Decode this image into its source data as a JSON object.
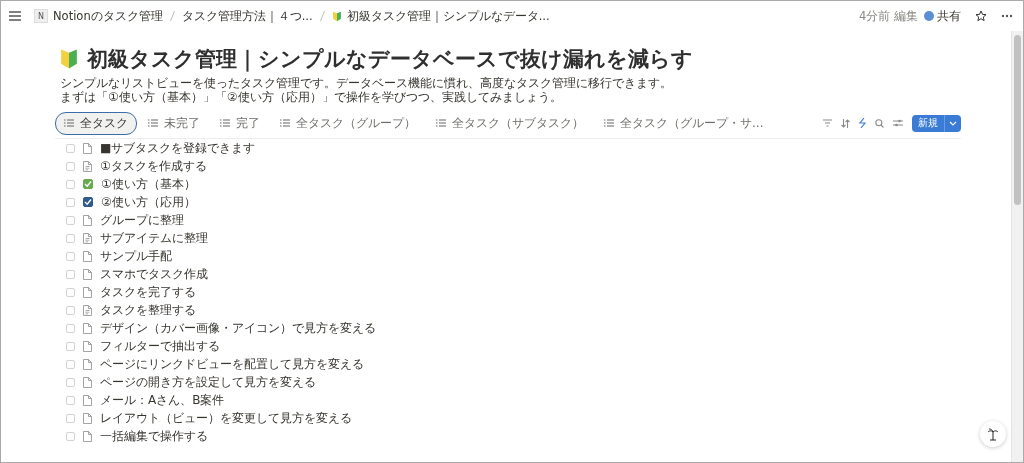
{
  "topbar": {
    "breadcrumbs": [
      {
        "text": "Notionのタスク管理",
        "icon": "N"
      },
      {
        "text": "タスク管理方法｜４つ..."
      },
      {
        "text": "初級タスク管理｜シンプルなデータ..."
      }
    ],
    "edited": "4分前 編集",
    "share": "共有"
  },
  "page": {
    "title": "初級タスク管理｜シンプルなデータベースで抜け漏れを減らす",
    "description": [
      "シンプルなリストビューを使ったタスク管理です。データベース機能に慣れ、高度なタスク管理に移行できます。",
      "まずは「①使い方（基本）」「②使い方（応用）」で操作を学びつつ、実践してみましょう。"
    ]
  },
  "views": [
    {
      "label": "全タスク",
      "selected": true
    },
    {
      "label": "未完了",
      "selected": false
    },
    {
      "label": "完了",
      "selected": false
    },
    {
      "label": "全タスク（グループ）",
      "selected": false
    },
    {
      "label": "全タスク（サブタスク）",
      "selected": false
    },
    {
      "label": "全タスク（グループ・サ...",
      "selected": false
    }
  ],
  "new_button": "新規",
  "items": [
    {
      "kind": "page",
      "title": "■サブタスクを登録できます",
      "selected": false
    },
    {
      "kind": "doc",
      "title": "①タスクを作成する",
      "selected": false
    },
    {
      "kind": "checkbox",
      "title": "①使い方（基本）",
      "checked": true,
      "color": "#6aa84f",
      "selected": false
    },
    {
      "kind": "checkbox",
      "title": "②使い方（応用）",
      "checked": true,
      "color": "#2f5a8a",
      "selected": false
    },
    {
      "kind": "page",
      "title": "グループに整理",
      "selected": false
    },
    {
      "kind": "doc",
      "title": "サブアイテムに整理",
      "selected": false
    },
    {
      "kind": "page",
      "title": "サンプル手配",
      "selected": false
    },
    {
      "kind": "page",
      "title": "スマホでタスク作成",
      "selected": false
    },
    {
      "kind": "page",
      "title": "タスクを完了する",
      "selected": false
    },
    {
      "kind": "doc",
      "title": "タスクを整理する",
      "selected": false
    },
    {
      "kind": "page",
      "title": "デザイン（カバー画像・アイコン）で見方を変える",
      "selected": false
    },
    {
      "kind": "page",
      "title": "フィルターで抽出する",
      "selected": false
    },
    {
      "kind": "page",
      "title": "ページにリンクドビューを配置して見方を変える",
      "selected": false
    },
    {
      "kind": "page",
      "title": "ページの開き方を設定して見方を変える",
      "selected": false
    },
    {
      "kind": "page",
      "title": "メール：Aさん、B案件",
      "selected": false
    },
    {
      "kind": "page",
      "title": "レイアウト（ビュー）を変更して見方を変える",
      "selected": false
    },
    {
      "kind": "page",
      "title": "一括編集で操作する",
      "selected": false
    }
  ]
}
